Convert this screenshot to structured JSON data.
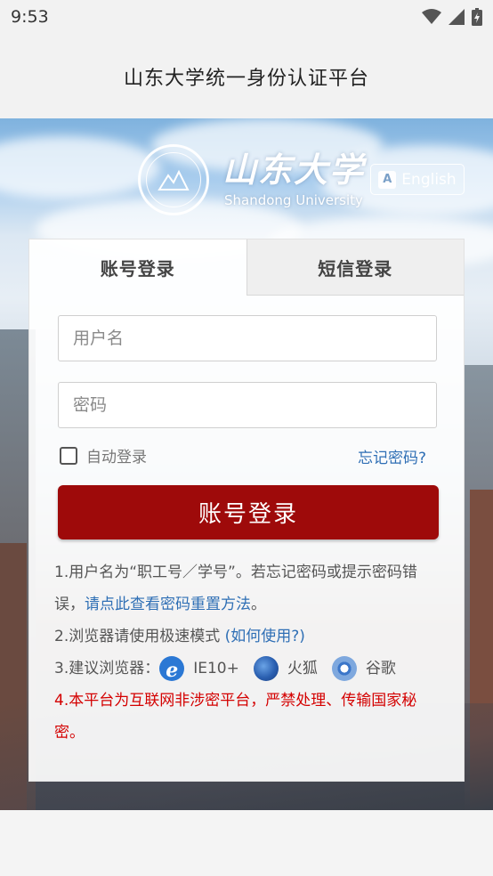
{
  "status_bar": {
    "time": "9:53"
  },
  "app_bar": {
    "title": "山东大学统一身份认证平台"
  },
  "brand": {
    "name_cn": "山东大学",
    "name_en": "Shandong University",
    "language_button": "English"
  },
  "tabs": [
    {
      "label": "账号登录",
      "active": true
    },
    {
      "label": "短信登录",
      "active": false
    }
  ],
  "form": {
    "username_placeholder": "用户名",
    "password_placeholder": "密码",
    "remember_label": "自动登录",
    "forgot_link": "忘记密码?",
    "submit_label": "账号登录"
  },
  "notes": {
    "note1_text": "1.用户名为“职工号／学号”。若忘记密码或提示密码错误，",
    "note1_link": "请点此查看密码重置方法",
    "note1_end": "。",
    "note2_text": "2.浏览器请使用极速模式",
    "note2_link": "(如何使用?)",
    "note3_text": "3.建议浏览器：",
    "browsers": [
      {
        "icon": "ie-icon",
        "label": "IE10+"
      },
      {
        "icon": "firefox-icon",
        "label": "火狐"
      },
      {
        "icon": "chrome-icon",
        "label": "谷歌"
      }
    ],
    "note4_text": "4.本平台为互联网非涉密平台，严禁处理、传输国家秘密。"
  },
  "colors": {
    "primary_button": "#9e0a0a",
    "link": "#2f6fb5",
    "warning": "#d40000"
  }
}
